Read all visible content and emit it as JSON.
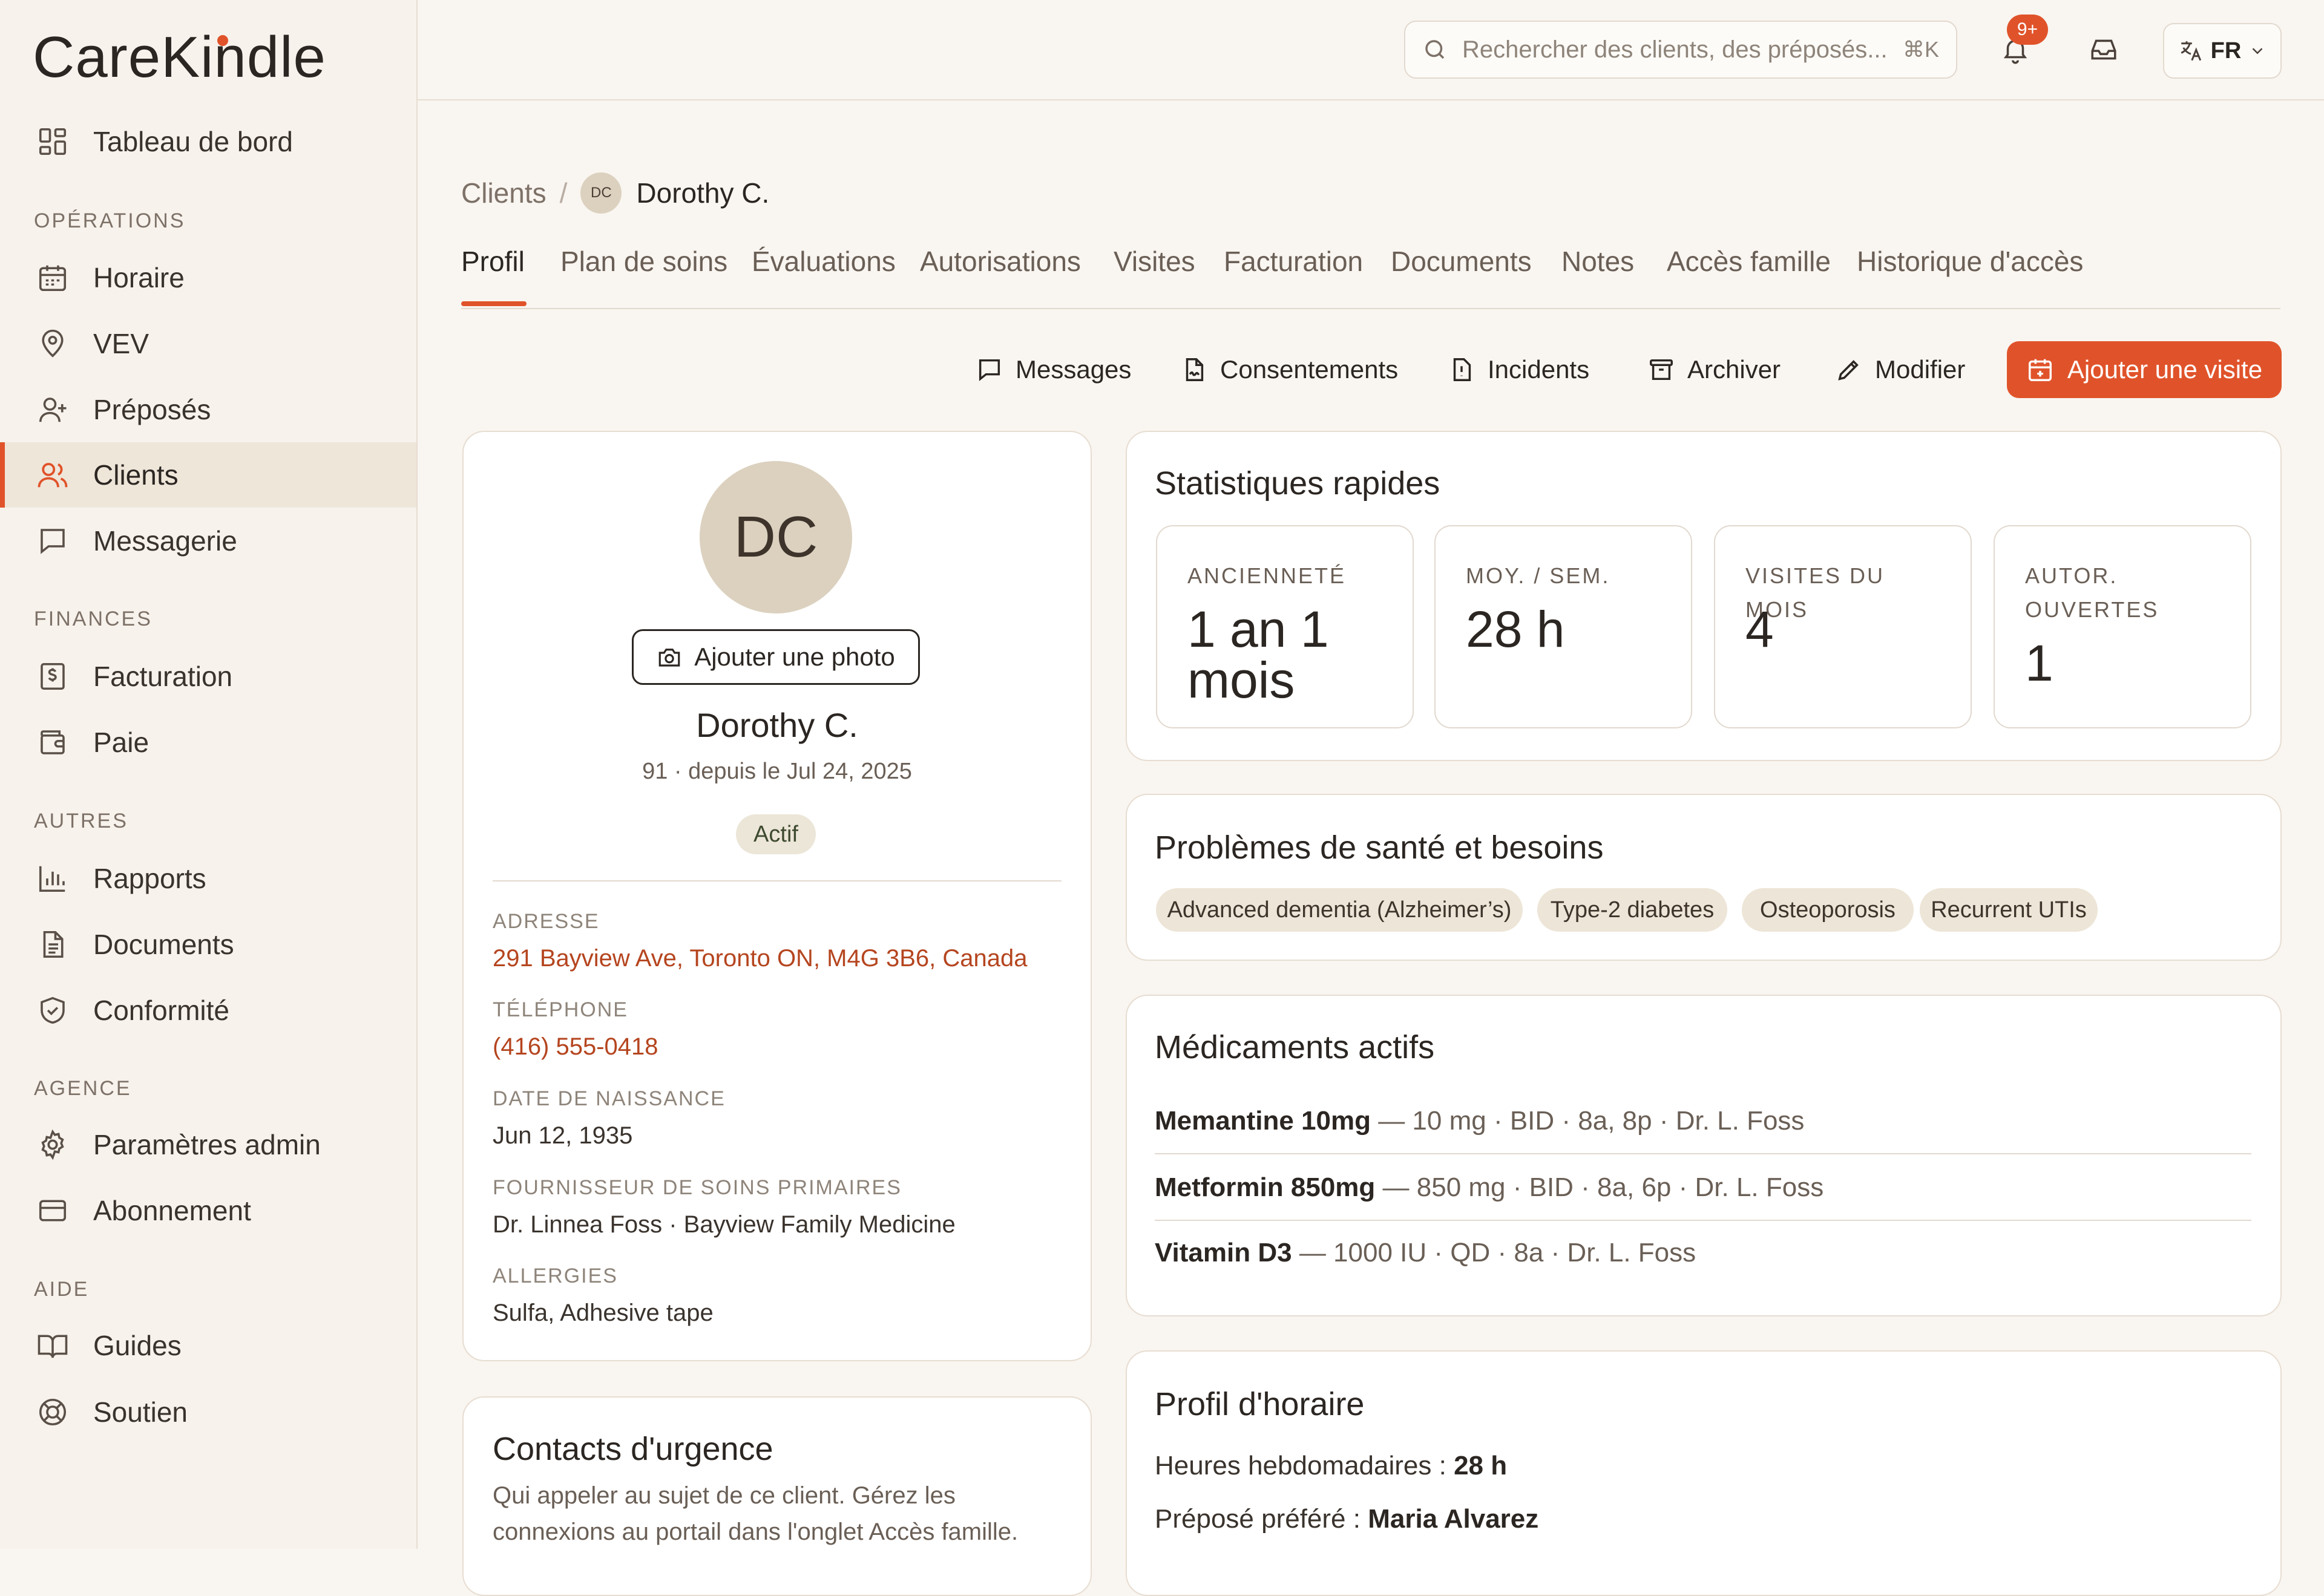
{
  "app": {
    "logo": "CareKindle",
    "accent": "#e0532a"
  },
  "sidebar": {
    "top": [
      {
        "label": "Tableau de bord",
        "icon": "dashboard-icon"
      }
    ],
    "sections": [
      {
        "label": "OPÉRATIONS",
        "items": [
          {
            "label": "Horaire",
            "icon": "calendar-icon"
          },
          {
            "label": "VEV",
            "icon": "map-pin-icon"
          },
          {
            "label": "Préposés",
            "icon": "user-plus-icon"
          },
          {
            "label": "Clients",
            "icon": "users-icon",
            "active": true
          },
          {
            "label": "Messagerie",
            "icon": "message-icon"
          }
        ]
      },
      {
        "label": "FINANCES",
        "items": [
          {
            "label": "Facturation",
            "icon": "invoice-icon"
          },
          {
            "label": "Paie",
            "icon": "wallet-icon"
          }
        ]
      },
      {
        "label": "AUTRES",
        "items": [
          {
            "label": "Rapports",
            "icon": "bar-chart-icon"
          },
          {
            "label": "Documents",
            "icon": "document-icon"
          },
          {
            "label": "Conformité",
            "icon": "shield-check-icon"
          }
        ]
      },
      {
        "label": "AGENCE",
        "items": [
          {
            "label": "Paramètres admin",
            "icon": "gear-icon"
          },
          {
            "label": "Abonnement",
            "icon": "credit-card-icon"
          }
        ]
      },
      {
        "label": "AIDE",
        "items": [
          {
            "label": "Guides",
            "icon": "book-icon"
          },
          {
            "label": "Soutien",
            "icon": "lifebuoy-icon"
          }
        ]
      }
    ]
  },
  "topbar": {
    "search_placeholder": "Rechercher des clients, des préposés...",
    "search_shortcut": "⌘K",
    "notifications_badge": "9+",
    "language": "FR"
  },
  "breadcrumb": {
    "parent": "Clients",
    "initials": "DC",
    "current": "Dorothy C."
  },
  "tabs": [
    "Profil",
    "Plan de soins",
    "Évaluations",
    "Autorisations",
    "Visites",
    "Facturation",
    "Documents",
    "Notes",
    "Accès famille",
    "Historique d'accès"
  ],
  "actions": {
    "messages": "Messages",
    "consents": "Consentements",
    "incidents": "Incidents",
    "archive": "Archiver",
    "edit": "Modifier",
    "add_visit": "Ajouter une visite"
  },
  "profile": {
    "initials": "DC",
    "add_photo": "Ajouter une photo",
    "name": "Dorothy C.",
    "subtitle": "91 · depuis le Jul 24, 2025",
    "status": "Actif",
    "fields": [
      {
        "label": "ADRESSE",
        "value": "291 Bayview Ave, Toronto ON, M4G 3B6, Canada",
        "link": true
      },
      {
        "label": "TÉLÉPHONE",
        "value": "(416) 555-0418",
        "link": true
      },
      {
        "label": "DATE DE NAISSANCE",
        "value": "Jun 12, 1935"
      },
      {
        "label": "FOURNISSEUR DE SOINS PRIMAIRES",
        "value": "Dr. Linnea Foss · Bayview Family Medicine"
      },
      {
        "label": "ALLERGIES",
        "value": "Sulfa, Adhesive tape"
      }
    ]
  },
  "emergency": {
    "title": "Contacts d'urgence",
    "description_line1": "Qui appeler au sujet de ce client. Gérez les",
    "description_line2": "connexions au portail dans l'onglet Accès famille."
  },
  "stats": {
    "title": "Statistiques rapides",
    "items": [
      {
        "label": "ANCIENNETÉ",
        "value": "1 an 1 mois"
      },
      {
        "label": "MOY. / SEM.",
        "value": "28 h"
      },
      {
        "label": "VISITES DU MOIS",
        "value": "4"
      },
      {
        "label": "AUTOR. OUVERTES",
        "value": "1"
      }
    ]
  },
  "health": {
    "title": "Problèmes de santé et besoins",
    "conditions": [
      "Advanced dementia (Alzheimer’s)",
      "Type-2 diabetes",
      "Osteoporosis",
      "Recurrent UTIs"
    ]
  },
  "medications": {
    "title": "Médicaments actifs",
    "items": [
      {
        "name": "Memantine 10mg",
        "detail": " — 10 mg · BID · 8a, 8p · Dr. L. Foss"
      },
      {
        "name": "Metformin 850mg",
        "detail": " — 850 mg · BID · 8a, 6p · Dr. L. Foss"
      },
      {
        "name": "Vitamin D3",
        "detail": " — 1000 IU · QD · 8a · Dr. L. Foss"
      }
    ]
  },
  "schedule": {
    "title": "Profil d'horaire",
    "weekly_label": "Heures hebdomadaires : ",
    "weekly_value": "28 h",
    "preferred_label": "Préposé préféré : ",
    "preferred_value": "Maria Alvarez"
  }
}
